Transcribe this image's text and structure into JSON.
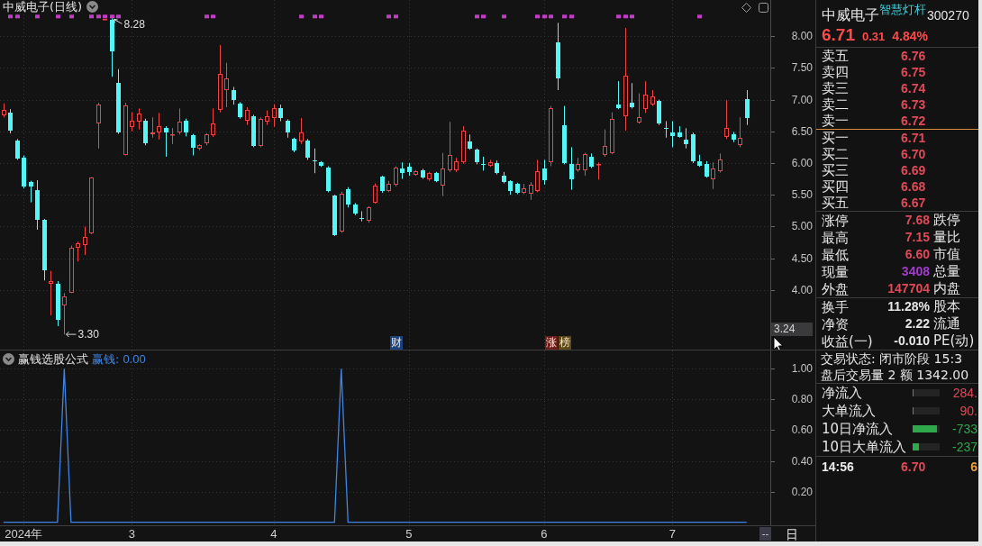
{
  "main_chart": {
    "title": "中威电子(日线)",
    "cursor_price": "3.24",
    "event_badges": [
      {
        "text": "财",
        "color": "#1d4280"
      },
      {
        "text": "涨",
        "color": "#6e1c1c"
      },
      {
        "text": "榜",
        "color": "#5e4818"
      }
    ],
    "chart_data": {
      "type": "candlestick",
      "ylim": [
        3.06,
        8.57
      ],
      "yticks": [
        {
          "value": 4,
          "label": "4.00"
        },
        {
          "value": 4.5,
          "label": "4.50"
        },
        {
          "value": 5,
          "label": "5.00"
        },
        {
          "value": 5.5,
          "label": "5.50"
        },
        {
          "value": 6,
          "label": "6.00"
        },
        {
          "value": 6.5,
          "label": "6.50"
        },
        {
          "value": 7,
          "label": "7.00"
        },
        {
          "value": 7.5,
          "label": "7.50"
        },
        {
          "value": 8,
          "label": "8.00"
        }
      ],
      "grid": true,
      "annotations": [
        "8.28",
        "3.30"
      ],
      "series": [
        {
          "type": "scatter",
          "marker": "square",
          "color": "#c23cc6",
          "values": [
            null,
            8.31,
            8.31,
            null,
            null,
            8.31,
            null,
            null,
            8.31,
            null,
            8.31,
            null,
            null,
            8.31,
            8.31,
            8.31,
            8.31,
            8.31,
            null,
            null,
            null,
            null,
            null,
            null,
            null,
            null,
            null,
            null,
            null,
            null,
            8.31,
            8.31,
            null,
            null,
            null,
            null,
            null,
            null,
            null,
            null,
            null,
            null,
            null,
            null,
            8.31,
            null,
            8.31,
            8.31,
            null,
            null,
            null,
            null,
            null,
            null,
            null,
            null,
            null,
            8.31,
            8.31,
            null,
            null,
            null,
            null,
            null,
            null,
            null,
            null,
            null,
            null,
            null,
            8.31,
            8.31,
            null,
            null,
            8.31,
            null,
            null,
            null,
            null,
            8.31,
            8.31,
            8.31,
            null,
            8.31,
            8.31,
            null,
            null,
            null,
            null,
            null,
            null,
            8.31,
            8.31,
            8.31,
            null,
            null,
            null,
            null,
            null,
            null,
            null,
            null,
            null,
            8.31,
            null,
            null,
            null,
            null,
            null,
            null,
            null,
            null,
            null,
            null
          ]
        }
      ],
      "ohlc": [
        [
          6.75,
          6.94,
          6.72,
          6.84
        ],
        [
          6.79,
          6.85,
          6.47,
          6.51
        ],
        [
          6.35,
          6.38,
          6.05,
          6.07
        ],
        [
          6.09,
          6.12,
          5.6,
          5.63
        ],
        [
          5.7,
          5.72,
          5.38,
          5.63
        ],
        [
          5.57,
          5.73,
          4.95,
          5.11
        ],
        [
          5.11,
          5.12,
          4.15,
          4.31
        ],
        [
          4.1,
          4.3,
          3.6,
          4.14
        ],
        [
          4.1,
          4.14,
          3.43,
          3.53
        ],
        [
          3.76,
          3.95,
          3.3,
          3.9
        ],
        [
          3.96,
          4.7,
          3.95,
          4.67
        ],
        [
          4.67,
          4.76,
          4.45,
          4.74
        ],
        [
          4.71,
          5.0,
          4.55,
          4.83
        ],
        [
          4.89,
          5.78,
          4.88,
          5.77
        ],
        [
          6.62,
          6.95,
          6.23,
          6.92
        ],
        [
          8.27,
          8.27,
          8.27,
          8.27
        ],
        [
          8.26,
          8.28,
          7.36,
          7.76
        ],
        [
          7.26,
          7.48,
          6.46,
          6.48
        ],
        [
          6.13,
          6.95,
          6.12,
          6.91
        ],
        [
          6.57,
          6.8,
          6.5,
          6.67
        ],
        [
          6.65,
          6.86,
          6.53,
          6.78
        ],
        [
          6.67,
          6.7,
          6.28,
          6.31
        ],
        [
          6.45,
          6.72,
          6.4,
          6.48
        ],
        [
          6.48,
          6.79,
          6.37,
          6.58
        ],
        [
          6.56,
          6.58,
          6.1,
          6.48
        ],
        [
          6.44,
          6.55,
          6.3,
          6.45
        ],
        [
          6.48,
          6.86,
          6.45,
          6.65
        ],
        [
          6.67,
          6.7,
          6.42,
          6.48
        ],
        [
          6.44,
          6.46,
          6.12,
          6.24
        ],
        [
          6.23,
          6.3,
          6.2,
          6.28
        ],
        [
          6.31,
          6.47,
          6.28,
          6.45
        ],
        [
          6.44,
          6.86,
          6.41,
          6.62
        ],
        [
          6.84,
          7.86,
          6.8,
          7.4
        ],
        [
          7.15,
          7.58,
          6.88,
          7.33
        ],
        [
          7.15,
          7.2,
          6.92,
          7.0
        ],
        [
          6.94,
          6.96,
          6.7,
          6.72
        ],
        [
          6.67,
          6.88,
          6.6,
          6.84
        ],
        [
          6.74,
          6.76,
          6.25,
          6.27
        ],
        [
          6.27,
          6.72,
          6.25,
          6.7
        ],
        [
          6.65,
          6.83,
          6.6,
          6.74
        ],
        [
          6.71,
          6.93,
          6.57,
          6.87
        ],
        [
          6.86,
          6.92,
          6.66,
          6.71
        ],
        [
          6.67,
          6.69,
          6.4,
          6.48
        ],
        [
          6.38,
          6.4,
          6.17,
          6.2
        ],
        [
          6.34,
          6.71,
          6.3,
          6.48
        ],
        [
          6.35,
          6.38,
          6.05,
          6.09
        ],
        [
          6.04,
          6.23,
          5.84,
          6.03
        ],
        [
          6.02,
          6.03,
          5.94,
          5.96
        ],
        [
          5.93,
          5.95,
          5.54,
          5.56
        ],
        [
          5.49,
          5.5,
          4.85,
          4.87
        ],
        [
          4.92,
          5.55,
          4.9,
          5.52
        ],
        [
          5.59,
          5.62,
          5.3,
          5.35
        ],
        [
          5.35,
          5.37,
          5.18,
          5.21
        ],
        [
          5.14,
          5.24,
          5.08,
          5.13
        ],
        [
          5.09,
          5.32,
          5.06,
          5.3
        ],
        [
          5.38,
          5.68,
          5.36,
          5.65
        ],
        [
          5.79,
          5.8,
          5.53,
          5.56
        ],
        [
          5.56,
          5.72,
          5.54,
          5.67
        ],
        [
          5.66,
          5.95,
          5.63,
          5.93
        ],
        [
          5.92,
          6.01,
          5.75,
          5.85
        ],
        [
          5.94,
          6.0,
          5.8,
          5.86
        ],
        [
          5.82,
          5.89,
          5.8,
          5.87
        ],
        [
          5.89,
          5.91,
          5.75,
          5.77
        ],
        [
          5.74,
          5.86,
          5.72,
          5.84
        ],
        [
          5.84,
          5.86,
          5.7,
          5.72
        ],
        [
          5.65,
          6.16,
          5.48,
          5.92
        ],
        [
          5.89,
          6.65,
          5.86,
          6.13
        ],
        [
          5.89,
          6.08,
          5.86,
          6.03
        ],
        [
          6.01,
          6.58,
          5.99,
          6.51
        ],
        [
          6.34,
          6.45,
          6.21,
          6.23
        ],
        [
          6.21,
          6.23,
          5.98,
          6.01
        ],
        [
          5.99,
          6.1,
          5.88,
          5.98
        ],
        [
          5.96,
          6.05,
          5.94,
          6.01
        ],
        [
          6.0,
          6.04,
          5.82,
          5.84
        ],
        [
          5.8,
          5.86,
          5.68,
          5.7
        ],
        [
          5.72,
          5.73,
          5.5,
          5.56
        ],
        [
          5.67,
          5.69,
          5.51,
          5.53
        ],
        [
          5.53,
          5.67,
          5.51,
          5.6
        ],
        [
          5.52,
          5.7,
          5.42,
          5.66
        ],
        [
          5.56,
          6.05,
          5.54,
          5.87
        ],
        [
          5.91,
          6.05,
          5.66,
          5.73
        ],
        [
          6.01,
          6.9,
          5.95,
          6.87
        ],
        [
          7.9,
          8.21,
          7.15,
          7.33
        ],
        [
          6.6,
          6.9,
          5.98,
          6.0
        ],
        [
          5.99,
          6.25,
          5.58,
          5.75
        ],
        [
          5.89,
          6.08,
          5.86,
          5.99
        ],
        [
          5.89,
          6.16,
          5.8,
          6.14
        ],
        [
          6.1,
          6.15,
          5.92,
          5.94
        ],
        [
          5.98,
          6.01,
          5.74,
          5.99
        ],
        [
          6.13,
          6.53,
          6.1,
          6.27
        ],
        [
          6.16,
          6.8,
          6.14,
          6.7
        ],
        [
          6.92,
          7.29,
          6.85,
          6.87
        ],
        [
          6.74,
          8.13,
          6.51,
          7.38
        ],
        [
          6.95,
          7.26,
          6.86,
          6.88
        ],
        [
          6.64,
          7.1,
          6.62,
          6.72
        ],
        [
          6.85,
          7.29,
          6.79,
          7.08
        ],
        [
          6.92,
          7.15,
          6.9,
          7.05
        ],
        [
          6.98,
          7.0,
          6.6,
          6.62
        ],
        [
          6.56,
          6.66,
          6.4,
          6.55
        ],
        [
          6.48,
          6.66,
          6.25,
          6.43
        ],
        [
          6.48,
          6.58,
          6.4,
          6.41
        ],
        [
          6.37,
          6.55,
          6.23,
          6.3
        ],
        [
          6.45,
          6.48,
          6.0,
          6.03
        ],
        [
          6.03,
          6.13,
          5.94,
          5.96
        ],
        [
          5.99,
          6.03,
          5.77,
          5.79
        ],
        [
          5.74,
          6.01,
          5.59,
          5.91
        ],
        [
          5.87,
          6.15,
          5.85,
          6.06
        ],
        [
          6.41,
          6.99,
          6.38,
          6.55
        ],
        [
          6.45,
          6.49,
          6.33,
          6.37
        ],
        [
          6.28,
          6.72,
          6.25,
          6.4
        ],
        [
          7.01,
          7.15,
          6.6,
          6.71
        ],
        null,
        null,
        null
      ]
    }
  },
  "indicator": {
    "title": "赢钱选股公式",
    "series_label": "赢钱:",
    "reading": "0.00",
    "chart_data": {
      "type": "line",
      "color": "#3f84e4",
      "ylim": [
        -0.02,
        1.12
      ],
      "yticks": [
        {
          "value": 0.2,
          "label": "0.20"
        },
        {
          "value": 0.4,
          "label": "0.40"
        },
        {
          "value": 0.6,
          "label": "0.60"
        },
        {
          "value": 0.8,
          "label": "0.80"
        },
        {
          "value": 1,
          "label": "1.00"
        }
      ],
      "grid": true,
      "categories": [
        null,
        null,
        null,
        "2024年",
        null,
        null,
        null,
        null,
        null,
        null,
        null,
        null,
        null,
        null,
        null,
        null,
        null,
        null,
        null,
        "3",
        null,
        null,
        null,
        null,
        null,
        null,
        null,
        null,
        null,
        null,
        null,
        null,
        null,
        null,
        null,
        null,
        null,
        null,
        null,
        null,
        "4",
        null,
        null,
        null,
        null,
        null,
        null,
        null,
        null,
        null,
        null,
        null,
        null,
        null,
        null,
        null,
        null,
        null,
        null,
        null,
        "5",
        null,
        null,
        null,
        null,
        null,
        null,
        null,
        null,
        null,
        null,
        null,
        null,
        null,
        null,
        null,
        null,
        null,
        null,
        null,
        "6",
        null,
        null,
        null,
        null,
        null,
        null,
        null,
        null,
        null,
        null,
        null,
        null,
        null,
        null,
        null,
        null,
        null,
        null,
        "7",
        null,
        null,
        null,
        null,
        null,
        null,
        null,
        null,
        null,
        null,
        null,
        null,
        null,
        null
      ],
      "values": [
        0,
        0,
        0,
        0,
        0,
        0,
        0,
        0,
        0,
        1,
        0,
        0,
        0,
        0,
        0,
        0,
        0,
        0,
        0,
        0,
        0,
        0,
        0,
        0,
        0,
        0,
        0,
        0,
        0,
        0,
        0,
        0,
        0,
        0,
        0,
        0,
        0,
        0,
        0,
        0,
        0,
        0,
        0,
        0,
        0,
        0,
        0,
        0,
        0,
        0,
        1,
        0,
        0,
        0,
        0,
        0,
        0,
        0,
        0,
        0,
        0,
        0,
        0,
        0,
        0,
        0,
        0,
        0,
        0,
        0,
        0,
        0,
        0,
        0,
        0,
        0,
        0,
        0,
        0,
        0,
        0,
        0,
        0,
        0,
        0,
        0,
        0,
        0,
        0,
        0,
        0,
        0,
        0,
        0,
        0,
        0,
        0,
        0,
        0,
        0,
        0,
        0,
        0,
        0,
        0,
        0,
        0,
        0,
        0,
        0,
        0,
        null,
        null,
        null
      ]
    }
  },
  "bottom_bar": {
    "toggle_button": "--",
    "period_button": "日"
  },
  "quote_panel": {
    "name": "中威电子",
    "concept": "智慧灯杆",
    "code": "300270",
    "price": "6.71",
    "change": "0.31",
    "change_pct": "4.84%",
    "asks": [
      {
        "label": "卖五",
        "price": "6.76"
      },
      {
        "label": "卖四",
        "price": "6.75"
      },
      {
        "label": "卖三",
        "price": "6.74"
      },
      {
        "label": "卖二",
        "price": "6.73"
      },
      {
        "label": "卖一",
        "price": "6.72"
      }
    ],
    "bids": [
      {
        "label": "买一",
        "price": "6.71"
      },
      {
        "label": "买二",
        "price": "6.70"
      },
      {
        "label": "买三",
        "price": "6.69"
      },
      {
        "label": "买四",
        "price": "6.68"
      },
      {
        "label": "买五",
        "price": "6.67"
      }
    ],
    "stats": [
      {
        "label": "涨停",
        "value": "7.68",
        "label2": "跌停",
        "color": "#e04a58"
      },
      {
        "label": "最高",
        "value": "7.15",
        "label2": "量比",
        "color": "#e04a58"
      },
      {
        "label": "最低",
        "value": "6.60",
        "label2": "市值",
        "color": "#e04a58"
      },
      {
        "label": "现量",
        "value": "3408",
        "label2": "总量",
        "color": "#a23ccc"
      },
      {
        "label": "外盘",
        "value": "147704",
        "label2": "内盘",
        "color": "#e04a58"
      }
    ],
    "fundamentals": [
      {
        "label": "换手",
        "value": "11.28%",
        "label2": "股本"
      },
      {
        "label": "净资",
        "value": "2.22",
        "label2": "流通"
      },
      {
        "label": "收益(一)",
        "value": "-0.010",
        "label2": "PE(动)"
      }
    ],
    "trade_status": [
      "交易状态: 闭市阶段 15:3",
      "盘后交易量 2 额 1342.00"
    ],
    "fund_flows": [
      {
        "label": "净流入",
        "value": "284.",
        "color": "#e04a58",
        "level": 0.04
      },
      {
        "label": "大单流入",
        "value": "90.",
        "color": "#e04a58",
        "level": 0.04
      },
      {
        "label": "10日净流入",
        "value": "-733",
        "color": "#2fa84c",
        "level": 0.9
      },
      {
        "label": "10日大单流入",
        "value": "-237",
        "color": "#2fa84c",
        "level": 0.23
      }
    ],
    "ticks": [
      {
        "time": "14:56",
        "price": "6.70",
        "volume": "6"
      }
    ]
  }
}
